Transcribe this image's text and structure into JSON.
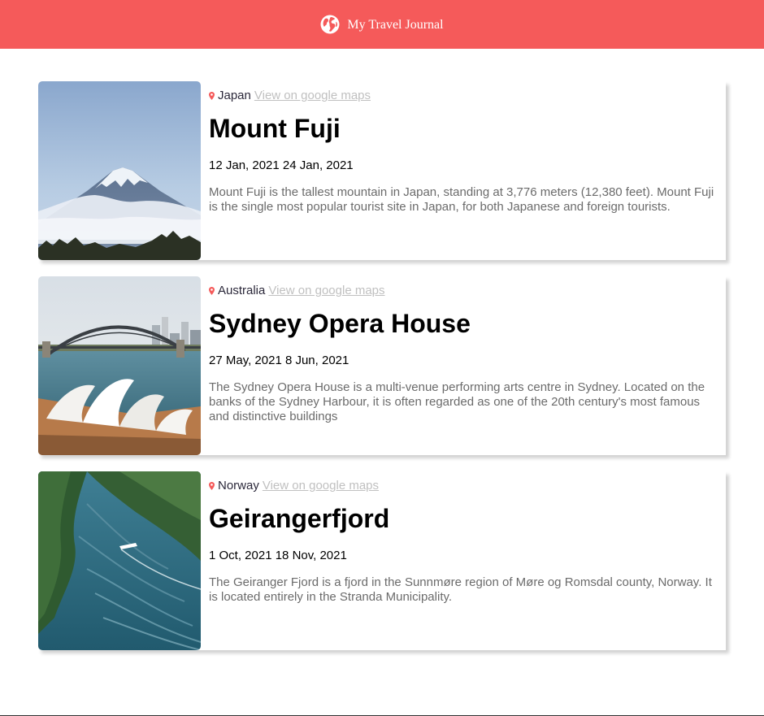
{
  "header": {
    "title": "My Travel Journal",
    "icon": "globe-icon",
    "background": "#f55a5a"
  },
  "entries": [
    {
      "country": "Japan",
      "maps_link": "View on google maps",
      "place": "Mount Fuji",
      "dates": "12 Jan, 2021 24 Jan, 2021",
      "description": "Mount Fuji is the tallest mountain in Japan, standing at 3,776 meters (12,380 feet). Mount Fuji is the single most popular tourist site in Japan, for both Japanese and foreign tourists."
    },
    {
      "country": "Australia",
      "maps_link": "View on google maps",
      "place": "Sydney Opera House",
      "dates": "27 May, 2021 8 Jun, 2021",
      "description": "The Sydney Opera House is a multi-venue performing arts centre in Sydney. Located on the banks of the Sydney Harbour, it is often regarded as one of the 20th century's most famous and distinctive buildings"
    },
    {
      "country": "Norway",
      "maps_link": "View on google maps",
      "place": "Geirangerfjord",
      "dates": "1 Oct, 2021 18 Nov, 2021",
      "description": "The Geiranger Fjord is a fjord in the Sunnmøre region of Møre og Romsdal county, Norway. It is located entirely in the Stranda Municipality."
    }
  ],
  "colors": {
    "accent": "#f55a5a",
    "link": "#c0c0c0",
    "description": "#6b6b6b"
  }
}
